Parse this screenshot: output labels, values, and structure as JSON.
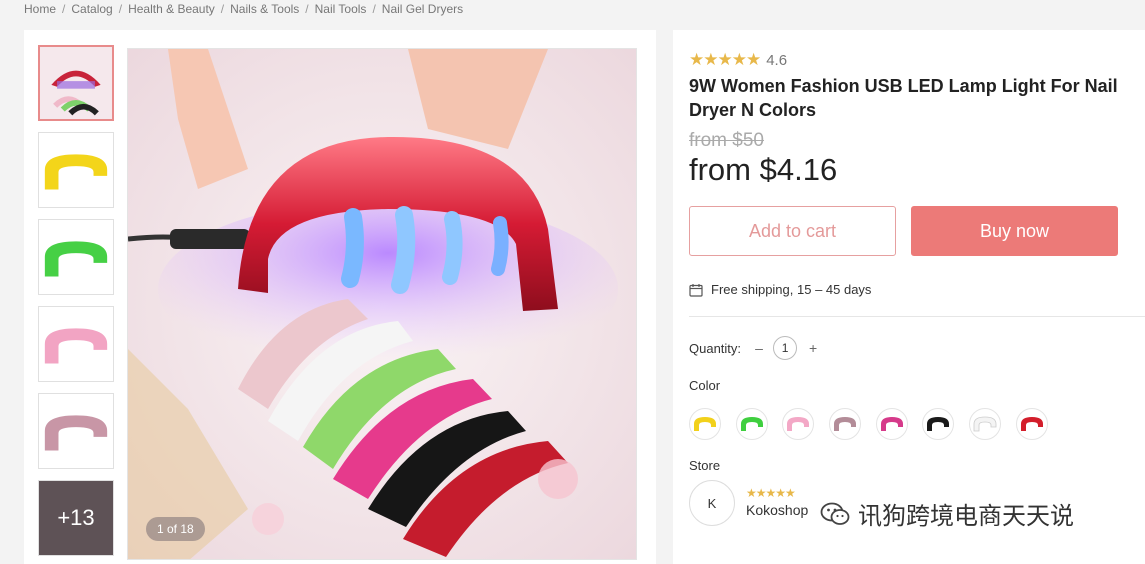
{
  "breadcrumb": [
    "Home",
    "Catalog",
    "Health & Beauty",
    "Nails & Tools",
    "Nail Tools",
    "Nail Gel Dryers"
  ],
  "gallery": {
    "thumbnail_colors": [
      "#f3d51a",
      "#46d045",
      "#f2a4c3",
      "#c896a6"
    ],
    "more_label": "+13",
    "counter": "1 of 18"
  },
  "product": {
    "rating_stars": "★★★★★",
    "rating": "4.6",
    "title": "9W Women Fashion USB LED Lamp Light For Nail Dryer N Colors",
    "old_price": "from $50",
    "price": "from $4.16",
    "add_to_cart": "Add to cart",
    "buy_now": "Buy now",
    "shipping": "Free shipping, 15 – 45 days",
    "quantity_label": "Quantity:",
    "quantity_minus": "–",
    "quantity": "1",
    "quantity_plus": "+",
    "color_label": "Color",
    "color_swatches": [
      "#f2d11b",
      "#3fcf3f",
      "#f3a8c6",
      "#b38c98",
      "#d63a8a",
      "#1a1a1a",
      "#f4f4f4",
      "#d31e2b"
    ],
    "store_label": "Store",
    "store_avatar": "K",
    "store_stars": "★★★★★",
    "store_name": "Kokoshop"
  },
  "colors": {
    "accent": "#ec7a78",
    "star": "#e8b84a"
  },
  "watermark": "讯狗跨境电商天天说"
}
